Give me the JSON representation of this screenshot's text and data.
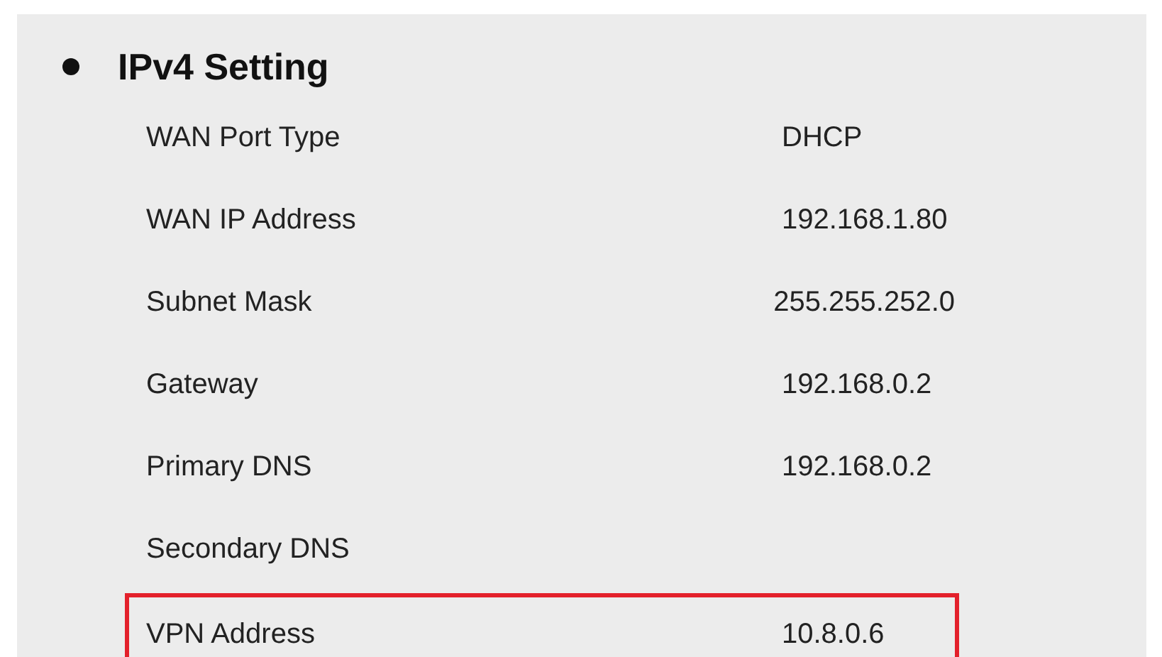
{
  "section": {
    "title": "IPv4 Setting",
    "rows": [
      {
        "label": "WAN Port Type",
        "value": "DHCP",
        "highlighted": false
      },
      {
        "label": "WAN IP Address",
        "value": "192.168.1.80",
        "highlighted": false
      },
      {
        "label": "Subnet Mask",
        "value": "255.255.252.0",
        "highlighted": false
      },
      {
        "label": "Gateway",
        "value": "192.168.0.2",
        "highlighted": false
      },
      {
        "label": "Primary DNS",
        "value": "192.168.0.2",
        "highlighted": false
      },
      {
        "label": "Secondary DNS",
        "highlighted": false
      },
      {
        "label": "VPN Address",
        "value": "10.8.0.6",
        "highlighted": true
      }
    ]
  }
}
